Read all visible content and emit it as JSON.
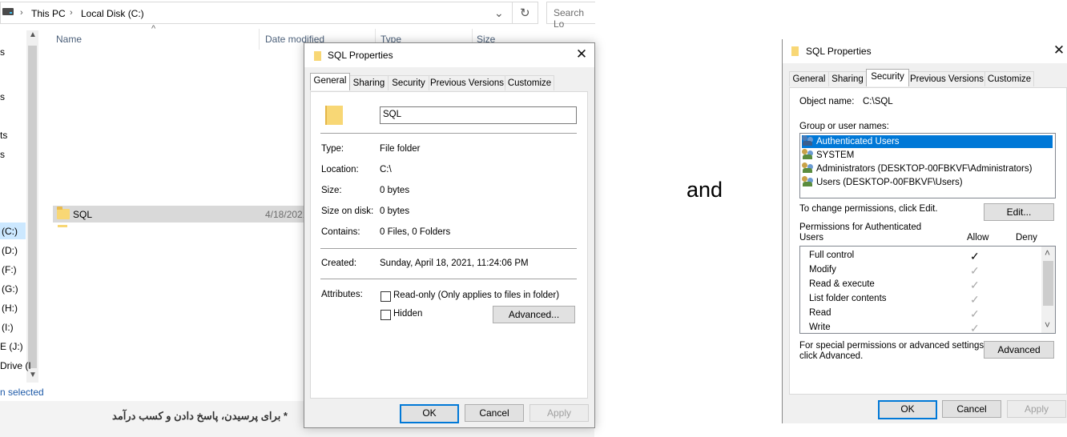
{
  "explorer": {
    "breadcrumb": [
      "This PC",
      "Local Disk (C:)"
    ],
    "search_placeholder": "Search Lo",
    "columns": [
      "Name",
      "Date modified",
      "Type",
      "Size"
    ],
    "row": {
      "name": "SQL",
      "date": "4/18/2021"
    },
    "nav_items": [
      "s",
      "s",
      "ts",
      "s",
      "(C:)",
      "(D:)",
      "(F:)",
      "(G:)",
      "(H:)",
      "(I:)",
      "E (J:)",
      "Drive (I"
    ],
    "status": "n selected",
    "bottom_text": "* برای پرسیدن، پاسخ دادن و کسب درآمد"
  },
  "dialog1": {
    "title": "SQL Properties",
    "tabs": [
      "General",
      "Sharing",
      "Security",
      "Previous Versions",
      "Customize"
    ],
    "active_tab": "General",
    "name_value": "SQL",
    "fields": [
      {
        "label": "Type:",
        "value": "File folder"
      },
      {
        "label": "Location:",
        "value": "C:\\"
      },
      {
        "label": "Size:",
        "value": "0 bytes"
      },
      {
        "label": "Size on disk:",
        "value": "0 bytes"
      },
      {
        "label": "Contains:",
        "value": "0 Files, 0 Folders"
      }
    ],
    "created_label": "Created:",
    "created_value": "Sunday, April 18, 2021, 11:24:06 PM",
    "attributes_label": "Attributes:",
    "readonly_label": "Read-only (Only applies to files in folder)",
    "hidden_label": "Hidden",
    "advanced_button": "Advanced...",
    "ok": "OK",
    "cancel": "Cancel",
    "apply": "Apply"
  },
  "separator_text": "and",
  "dialog2": {
    "title": "SQL Properties",
    "tabs": [
      "General",
      "Sharing",
      "Security",
      "Previous Versions",
      "Customize"
    ],
    "active_tab": "Security",
    "object_name_label": "Object name:",
    "object_name_value": "C:\\SQL",
    "group_label": "Group or user names:",
    "users": [
      "Authenticated Users",
      "SYSTEM",
      "Administrators (DESKTOP-00FBKVF\\Administrators)",
      "Users (DESKTOP-00FBKVF\\Users)"
    ],
    "selected_user_index": 0,
    "change_perm_text": "To change permissions, click Edit.",
    "edit_button": "Edit...",
    "perm_header": "Permissions for Authenticated Users",
    "perm_header_line1": "Permissions for Authenticated",
    "perm_header_line2": "Users",
    "allow_label": "Allow",
    "deny_label": "Deny",
    "permissions": [
      {
        "name": "Full control",
        "allow": true,
        "inherited": false
      },
      {
        "name": "Modify",
        "allow": true,
        "inherited": true
      },
      {
        "name": "Read & execute",
        "allow": true,
        "inherited": true
      },
      {
        "name": "List folder contents",
        "allow": true,
        "inherited": true
      },
      {
        "name": "Read",
        "allow": true,
        "inherited": true
      },
      {
        "name": "Write",
        "allow": true,
        "inherited": true
      }
    ],
    "special_text_line1": "For special permissions or advanced settings,",
    "special_text_line2": "click Advanced.",
    "advanced_button": "Advanced",
    "ok": "OK",
    "cancel": "Cancel",
    "apply": "Apply",
    "check_glyph": "✓"
  }
}
